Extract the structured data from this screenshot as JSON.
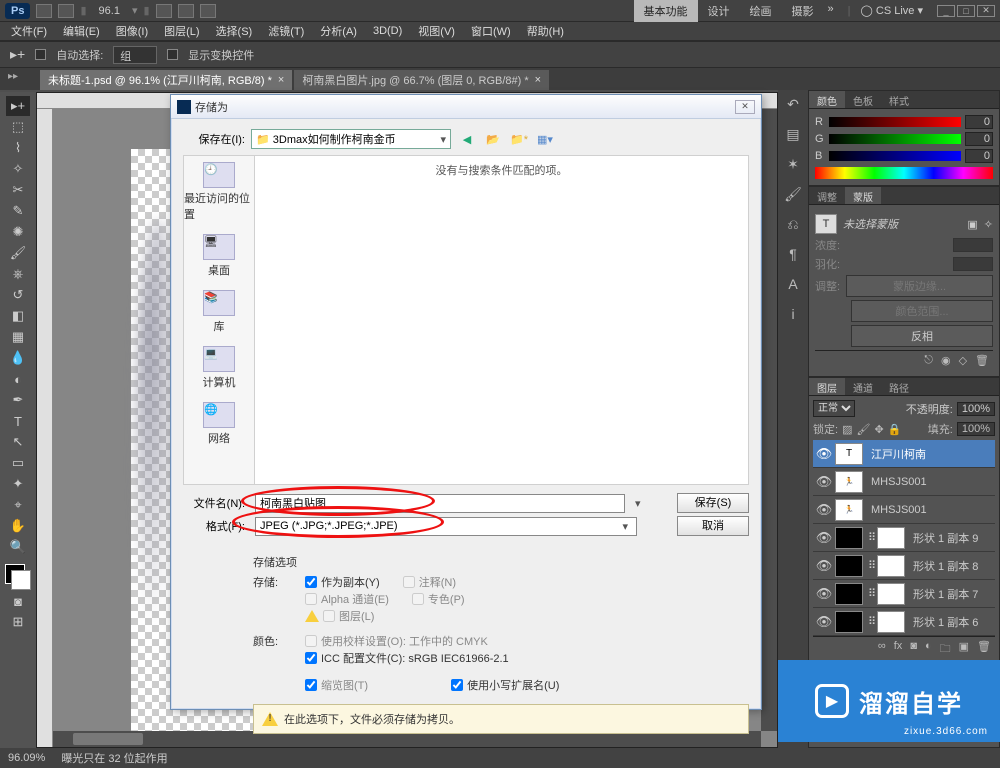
{
  "top": {
    "zoom": "96.1",
    "workspace": "基本功能",
    "ws2": "设计",
    "ws3": "绘画",
    "ws4": "摄影",
    "cslive": "CS Live"
  },
  "menu": [
    "文件(F)",
    "编辑(E)",
    "图像(I)",
    "图层(L)",
    "选择(S)",
    "滤镜(T)",
    "分析(A)",
    "3D(D)",
    "视图(V)",
    "窗口(W)",
    "帮助(H)"
  ],
  "opts": {
    "auto": "自动选择:",
    "group": "组",
    "show": "显示变换控件"
  },
  "tabs": {
    "t1": "未标题-1.psd @ 96.1% (江戸川柯南, RGB/8) *",
    "t2": "柯南黑白图片.jpg @ 66.7% (图层 0, RGB/8#) *"
  },
  "color": {
    "tab1": "颜色",
    "tab2": "色板",
    "tab3": "样式",
    "r": "R",
    "g": "G",
    "b": "B",
    "v": "0"
  },
  "adj": {
    "tab1": "调整",
    "tab2": "蒙版",
    "unsel": "未选择蒙版",
    "dens": "浓度:",
    "feather": "羽化:",
    "refine": "调整:",
    "b1": "蒙版边缘...",
    "b2": "颜色范围...",
    "b3": "反相"
  },
  "layers": {
    "tab1": "图层",
    "tab2": "通道",
    "tab3": "路径",
    "mode": "正常",
    "opac": "不透明度:",
    "opacv": "100%",
    "lock": "锁定:",
    "fill": "填充:",
    "fillv": "100%",
    "items": [
      {
        "name": "江戸川柯南",
        "kind": "T",
        "sel": true
      },
      {
        "name": "MHSJS001",
        "kind": "run"
      },
      {
        "name": "MHSJS001",
        "kind": "run"
      },
      {
        "name": "形状 1 副本 9",
        "kind": "shape"
      },
      {
        "name": "形状 1 副本 8",
        "kind": "shape"
      },
      {
        "name": "形状 1 副本 7",
        "kind": "shape"
      },
      {
        "name": "形状 1 副本 6",
        "kind": "shape"
      }
    ]
  },
  "status": {
    "zoom": "96.09%",
    "info": "曝光只在 32 位起作用"
  },
  "dialog": {
    "title": "存储为",
    "savein_lbl": "保存在(I):",
    "savein_val": "3Dmax如何制作柯南金币",
    "places": [
      "最近访问的位置",
      "桌面",
      "库",
      "计算机",
      "网络"
    ],
    "nomatch": "没有与搜索条件匹配的项。",
    "fname_lbl": "文件名(N):",
    "fname_val": "柯南黑白贴图",
    "fmt_lbl": "格式(F):",
    "fmt_val": "JPEG (*.JPG;*.JPEG;*.JPE)",
    "save_btn": "保存(S)",
    "cancel_btn": "取消",
    "opt_hdr": "存储选项",
    "store": "存储:",
    "copy": "作为副本(Y)",
    "notes": "注释(N)",
    "alpha": "Alpha 通道(E)",
    "spot": "专色(P)",
    "layer": "图层(L)",
    "color_hdr": "颜色:",
    "proof": "使用校样设置(O): 工作中的 CMYK",
    "icc": "ICC 配置文件(C): sRGB IEC61966-2.1",
    "thumb": "缩览图(T)",
    "lc": "使用小写扩展名(U)",
    "warn": "在此选项下，文件必须存储为拷贝。"
  },
  "wm": {
    "name": "溜溜自学",
    "url": "zixue.3d66.com"
  }
}
